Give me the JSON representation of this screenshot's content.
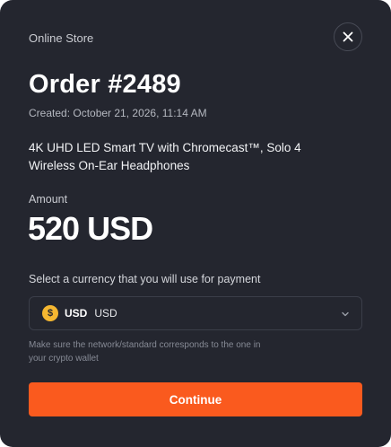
{
  "store": {
    "name": "Online Store"
  },
  "order": {
    "title": "Order #2489",
    "created": "Created: October 21, 2026, 11:14 AM",
    "products": "4K UHD LED Smart TV with Chromecast™, Solo 4 Wireless On-Ear Headphones"
  },
  "amount": {
    "label": "Amount",
    "value": "520 USD"
  },
  "currency": {
    "label": "Select a currency that you will use for payment",
    "selected_code": "USD",
    "selected_name": "USD",
    "coin_symbol": "$",
    "coin_color": "#f5b731"
  },
  "hint": "Make sure the network/standard corresponds to the one in your crypto wallet",
  "actions": {
    "continue_label": "Continue"
  },
  "colors": {
    "background": "#24262f",
    "accent": "#fa5a1e"
  },
  "icons": {
    "close": "close-icon",
    "chevron": "chevron-down-icon",
    "coin": "dollar-coin-icon"
  }
}
